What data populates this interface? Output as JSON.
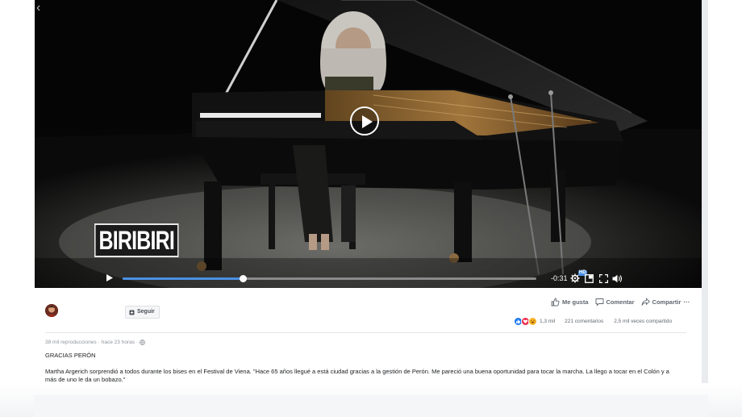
{
  "video": {
    "watermark": "BIRIBIRI",
    "time_remaining": "-0:31",
    "progress": 0.29,
    "hd_badge": "HD"
  },
  "post": {
    "follow_label": "Seguir",
    "actions": {
      "like": "Me gusta",
      "comment": "Comentar",
      "share": "Compartir",
      "more": "···"
    },
    "stats": {
      "reactions_count": "1,3 mil",
      "comments": "221 comentarios",
      "shares": "2,5 mil veces compartido"
    },
    "meta": {
      "views": "38 mil reproducciones",
      "separator": " · ",
      "time": "hace 23 horas",
      "separator2": " · "
    },
    "title": "GRACIAS PERÓN",
    "body": "Martha Argerich sorprendió a todos durante los bises en el Festival de Viena. \"Hace 65 años llegué a está ciudad gracias a la gestión de Perón. Me pareció una buena oportunidad para tocar la marcha. La llego a tocar en el Colón y a más de uno le da un bobazo.\""
  },
  "colors": {
    "progress_fill": "#4a90e2",
    "like_reaction": "#1877f2",
    "love_reaction": "#f0284a",
    "haha_reaction": "#f7b125"
  }
}
